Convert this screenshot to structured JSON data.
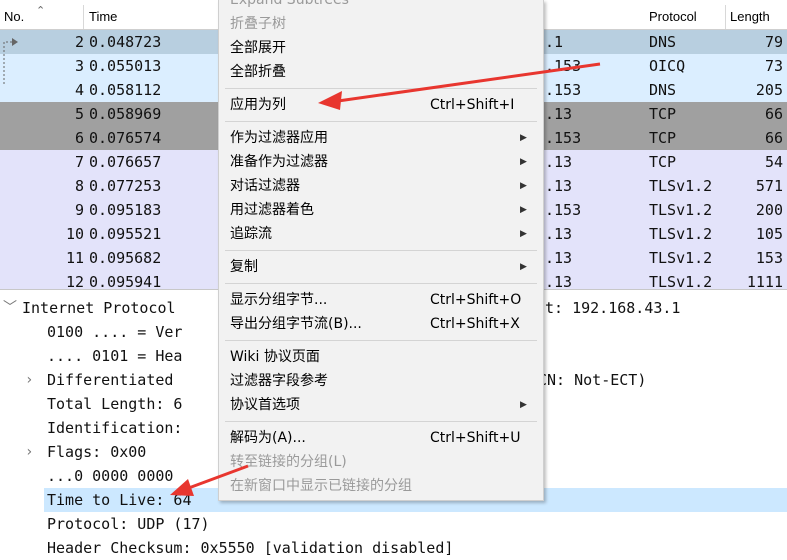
{
  "packet_list": {
    "columns": [
      "No.",
      "Time",
      "Protocol",
      "Length"
    ],
    "rows": [
      {
        "no": "2",
        "time": "0.048723",
        "dst": ".1",
        "proto": "DNS",
        "len": "79",
        "bg": "#b8cfe0"
      },
      {
        "no": "3",
        "time": "0.055013",
        "dst": ".153",
        "proto": "OICQ",
        "len": "73",
        "bg": "#dbeeff"
      },
      {
        "no": "4",
        "time": "0.058112",
        "dst": ".153",
        "proto": "DNS",
        "len": "205",
        "bg": "#dbeeff"
      },
      {
        "no": "5",
        "time": "0.058969",
        "dst": ".13",
        "proto": "TCP",
        "len": "66",
        "bg": "#a0a0a0"
      },
      {
        "no": "6",
        "time": "0.076574",
        "dst": ".153",
        "proto": "TCP",
        "len": "66",
        "bg": "#a0a0a0"
      },
      {
        "no": "7",
        "time": "0.076657",
        "dst": ".13",
        "proto": "TCP",
        "len": "54",
        "bg": "#e3e3fa"
      },
      {
        "no": "8",
        "time": "0.077253",
        "dst": ".13",
        "proto": "TLSv1.2",
        "len": "571",
        "bg": "#e3e3fa"
      },
      {
        "no": "9",
        "time": "0.095183",
        "dst": ".153",
        "proto": "TLSv1.2",
        "len": "200",
        "bg": "#e3e3fa"
      },
      {
        "no": "10",
        "time": "0.095521",
        "dst": ".13",
        "proto": "TLSv1.2",
        "len": "105",
        "bg": "#e3e3fa"
      },
      {
        "no": "11",
        "time": "0.095682",
        "dst": ".13",
        "proto": "TLSv1.2",
        "len": "153",
        "bg": "#e3e3fa"
      },
      {
        "no": "12",
        "time": "0.095941",
        "dst": ".13",
        "proto": "TLSv1.2",
        "len": "1111",
        "bg": "#e3e3fa"
      }
    ]
  },
  "detail": {
    "lines": [
      {
        "text": "Internet Protocol",
        "right": "t: 192.168.43.1",
        "indent": 0,
        "arrow": "﹀",
        "selected": false
      },
      {
        "text": "0100 .... = Ver",
        "right": "",
        "indent": 1,
        "arrow": "",
        "selected": false
      },
      {
        "text": ".... 0101 = Hea",
        "right": "",
        "indent": 1,
        "arrow": "",
        "selected": false
      },
      {
        "text": "Differentiated",
        "right": "CN: Not-ECT)",
        "indent": 1,
        "arrow": "›",
        "selected": false
      },
      {
        "text": "Total Length: 6",
        "right": "",
        "indent": 1,
        "arrow": "",
        "selected": false
      },
      {
        "text": "Identification:",
        "right": "",
        "indent": 1,
        "arrow": "",
        "selected": false
      },
      {
        "text": "Flags: 0x00",
        "right": "",
        "indent": 1,
        "arrow": "›",
        "selected": false
      },
      {
        "text": "...0 0000 0000",
        "right": "",
        "indent": 1,
        "arrow": "",
        "selected": false
      },
      {
        "text": "Time to Live: 64",
        "right": "",
        "indent": 1,
        "arrow": "",
        "selected": true
      },
      {
        "text": "Protocol: UDP (17)",
        "right": "",
        "indent": 1,
        "arrow": "",
        "selected": false
      },
      {
        "text": "Header Checksum: 0x5550 [validation disabled]",
        "right": "",
        "indent": 1,
        "arrow": "",
        "selected": false
      }
    ]
  },
  "context_menu": {
    "items": [
      {
        "label": "Expand Subtrees",
        "shortcut": "",
        "submenu": false,
        "disabled": true
      },
      {
        "label": "折叠子树",
        "shortcut": "",
        "submenu": false,
        "disabled": true
      },
      {
        "label": "全部展开",
        "shortcut": "",
        "submenu": false,
        "disabled": false
      },
      {
        "label": "全部折叠",
        "shortcut": "",
        "submenu": false,
        "disabled": false
      },
      {
        "sep": true
      },
      {
        "label": "应用为列",
        "shortcut": "Ctrl+Shift+I",
        "submenu": false,
        "disabled": false
      },
      {
        "sep": true
      },
      {
        "label": "作为过滤器应用",
        "shortcut": "",
        "submenu": true,
        "disabled": false
      },
      {
        "label": "准备作为过滤器",
        "shortcut": "",
        "submenu": true,
        "disabled": false
      },
      {
        "label": "对话过滤器",
        "shortcut": "",
        "submenu": true,
        "disabled": false
      },
      {
        "label": "用过滤器着色",
        "shortcut": "",
        "submenu": true,
        "disabled": false
      },
      {
        "label": "追踪流",
        "shortcut": "",
        "submenu": true,
        "disabled": false
      },
      {
        "sep": true
      },
      {
        "label": "复制",
        "shortcut": "",
        "submenu": true,
        "disabled": false
      },
      {
        "sep": true
      },
      {
        "label": "显示分组字节...",
        "shortcut": "Ctrl+Shift+O",
        "submenu": false,
        "disabled": false
      },
      {
        "label": "导出分组字节流(B)...",
        "shortcut": "Ctrl+Shift+X",
        "submenu": false,
        "disabled": false
      },
      {
        "sep": true
      },
      {
        "label": "Wiki 协议页面",
        "shortcut": "",
        "submenu": false,
        "disabled": false
      },
      {
        "label": "过滤器字段参考",
        "shortcut": "",
        "submenu": false,
        "disabled": false
      },
      {
        "label": "协议首选项",
        "shortcut": "",
        "submenu": true,
        "disabled": false
      },
      {
        "sep": true
      },
      {
        "label": "解码为(A)...",
        "shortcut": "Ctrl+Shift+U",
        "submenu": false,
        "disabled": false
      },
      {
        "label": "转至链接的分组(L)",
        "shortcut": "",
        "submenu": false,
        "disabled": true
      },
      {
        "label": "在新窗口中显示已链接的分组",
        "shortcut": "",
        "submenu": false,
        "disabled": true
      }
    ]
  },
  "colors": {
    "annotation_arrow": "#e8362f",
    "selection": "#cce8ff",
    "menu_bg": "#f2f2f2"
  }
}
